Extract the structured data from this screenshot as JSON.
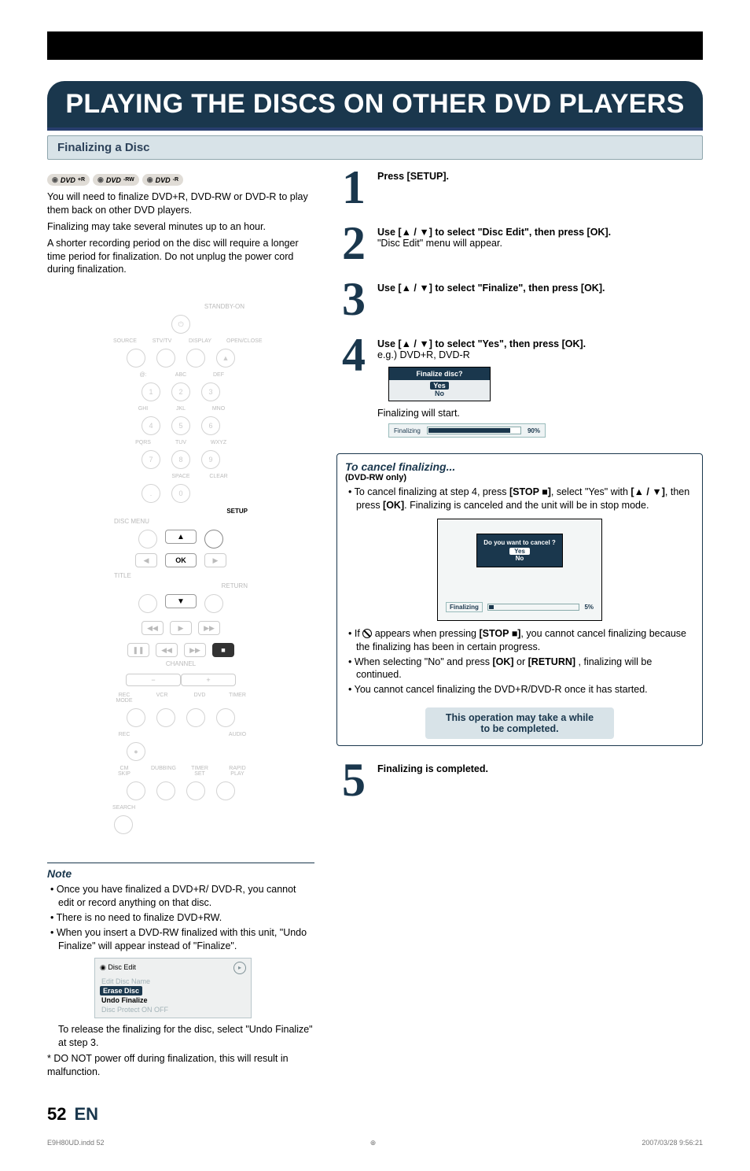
{
  "header_title": "PLAYING THE DISCS ON OTHER DVD PLAYERS",
  "subsection": "Finalizing a Disc",
  "disc_badges": [
    "DVD+R",
    "DVD-RW",
    "DVD-R"
  ],
  "intro": {
    "p1": "You will need to finalize DVD+R, DVD-RW or DVD-R to play them back on other DVD players.",
    "p2": "Finalizing may take several minutes up to an hour.",
    "p3": "A shorter recording period on the disc will require a longer time period for finalization. Do not unplug the power cord during finalization."
  },
  "remote": {
    "standby": "STANDBY-ON",
    "row1_labels": [
      "SOURCE",
      "STV/TV",
      "DISPLAY",
      "OPEN/CLOSE"
    ],
    "keypad_top_labels": [
      "@:",
      "ABC",
      "DEF"
    ],
    "keypad": [
      "1",
      "2",
      "3",
      "4",
      "5",
      "6",
      "7",
      "8",
      "9",
      ".",
      "0"
    ],
    "keypad_mid_labels": [
      "GHI",
      "JKL",
      "MNO",
      "PQRS",
      "TUV",
      "WXYZ",
      "",
      "SPACE",
      "CLEAR"
    ],
    "disc_menu": "DISC MENU",
    "setup": "SETUP",
    "ok": "OK",
    "title_label": "TITLE",
    "return_label": "RETURN",
    "channel": "CHANNEL",
    "bottom_labels": [
      "REC MODE",
      "VCR",
      "DVD",
      "TIMER",
      "REC",
      "",
      "",
      "AUDIO",
      "CM SKIP",
      "DUBBING",
      "TIMER SET",
      "RAPID PLAY",
      "SEARCH"
    ]
  },
  "note": {
    "header": "Note",
    "items": [
      "Once you have finalized a DVD+R/ DVD-R, you cannot edit or record anything on that disc.",
      "There is no need to finalize DVD+RW.",
      "When you insert a DVD-RW finalized with this unit, \"Undo Finalize\" will appear instead of  \"Finalize\"."
    ],
    "disc_edit": {
      "title": "Disc Edit",
      "items": [
        "Edit Disc Name",
        "Erase Disc",
        "Undo Finalize",
        "Disc Protect ON    OFF"
      ],
      "selected_index": 1,
      "active_index": 2
    },
    "post1": "To release the finalizing for the disc, select \"Undo Finalize\" at step 3.",
    "post2": "* DO NOT power off during finalization, this will result in malfunction."
  },
  "steps": {
    "s1": {
      "text": "Press [SETUP]."
    },
    "s2": {
      "line1a": "Use [",
      "line1b": " / ",
      "line1c": "] to select \"Disc Edit\", then press [OK].",
      "line2": "\"Disc Edit\" menu will appear."
    },
    "s3": {
      "a": "Use [",
      "b": " / ",
      "c": "] to select \"Finalize\", then press [OK]."
    },
    "s4": {
      "a": "Use [",
      "b": " / ",
      "c": "] to select \"Yes\", then press [OK].",
      "eg": "e.g.) DVD+R, DVD-R",
      "dialog_title": "Finalize disc?",
      "dialog_yes": "Yes",
      "dialog_no": "No",
      "start": "Finalizing will start.",
      "progress_label": "Finalizing",
      "progress_pct": "90%",
      "progress_fill": 90
    },
    "s5": {
      "text": "Finalizing is completed."
    }
  },
  "cancel": {
    "title": "To cancel finalizing...",
    "sub": "(DVD-RW only)",
    "i1a": "To cancel finalizing at step 4, press ",
    "i1b": "[STOP ■]",
    "i1c": ", select \"Yes\" with ",
    "i1d": "[▲ / ▼]",
    "i1e": ", then press ",
    "i1f": "[OK]",
    "i1g": ". Finalizing is canceled and the unit will be in stop mode.",
    "dialog_q": "Do you want to cancel ?",
    "dialog_yes": "Yes",
    "dialog_no": "No",
    "progress_label": "Finalizing",
    "progress_pct": "5%",
    "progress_fill": 5,
    "i2a": "If ",
    "i2b": " appears when pressing ",
    "i2c": "[STOP ■]",
    "i2d": ", you cannot cancel finalizing because the finalizing has been in certain progress.",
    "i3a": "When selecting \"No\" and press ",
    "i3b": "[OK]",
    "i3c": " or ",
    "i3d": "[RETURN]",
    "i3e": " , finalizing will be continued.",
    "i4": "You cannot cancel finalizing the DVD+R/DVD-R once it has started."
  },
  "notice": "This operation may take a while to be completed.",
  "footer": {
    "page": "52",
    "lang": "EN",
    "file": "E9H80UD.indd   52",
    "timestamp": "2007/03/28   9:56:21"
  }
}
